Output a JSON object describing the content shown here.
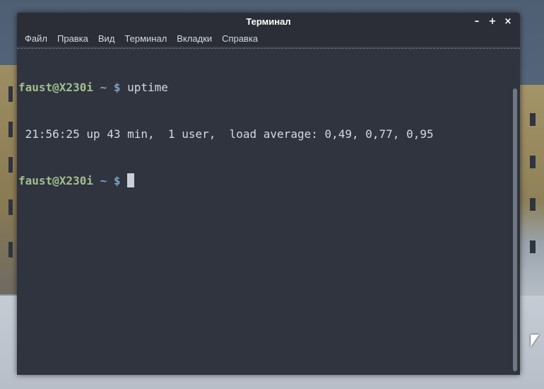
{
  "window": {
    "title": "Терминал",
    "controls": {
      "minimize": "–",
      "maximize": "+",
      "close": "×"
    }
  },
  "menu": {
    "items": [
      "Файл",
      "Правка",
      "Вид",
      "Терминал",
      "Вкладки",
      "Справка"
    ]
  },
  "terminal": {
    "lines": [
      {
        "user": "faust@X230i",
        "path": " ~ $",
        "command": " uptime"
      },
      {
        "output": " 21:56:25 up 43 min,  1 user,  load average: 0,49, 0,77, 0,95"
      },
      {
        "user": "faust@X230i",
        "path": " ~ $",
        "command": " "
      }
    ]
  },
  "colors": {
    "terminal_bg": "#2f343f",
    "prompt_user": "#a3be8c",
    "prompt_path": "#81a1c1",
    "text": "#d3dae3"
  }
}
